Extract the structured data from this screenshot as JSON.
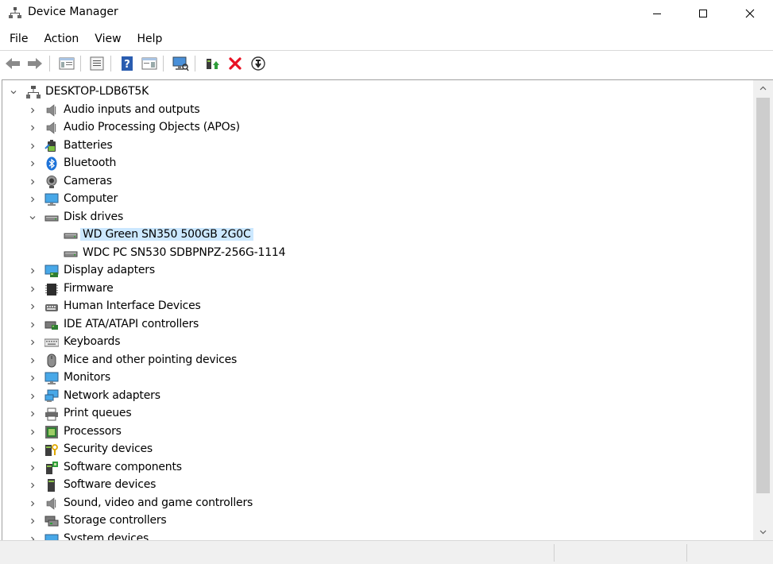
{
  "window": {
    "title": "Device Manager"
  },
  "menu": [
    "File",
    "Action",
    "View",
    "Help"
  ],
  "toolbar": [
    "back",
    "forward",
    "show-hide-console-tree",
    "properties",
    "help",
    "action-pane",
    "scan-hardware",
    "update-driver",
    "uninstall-device",
    "disable-device"
  ],
  "tree": {
    "root": "DESKTOP-LDB6T5K",
    "items": [
      {
        "label": "Audio inputs and outputs",
        "icon": "speaker-icon",
        "expanded": false
      },
      {
        "label": "Audio Processing Objects (APOs)",
        "icon": "speaker-icon",
        "expanded": false
      },
      {
        "label": "Batteries",
        "icon": "battery-icon",
        "expanded": false
      },
      {
        "label": "Bluetooth",
        "icon": "bluetooth-icon",
        "expanded": false
      },
      {
        "label": "Cameras",
        "icon": "camera-icon",
        "expanded": false
      },
      {
        "label": "Computer",
        "icon": "computer-icon",
        "expanded": false
      },
      {
        "label": "Disk drives",
        "icon": "disk-drive-icon",
        "expanded": true,
        "children": [
          {
            "label": "WD Green SN350 500GB 2G0C",
            "icon": "disk-drive-icon",
            "selected": true
          },
          {
            "label": "WDC PC SN530 SDBPNPZ-256G-1114",
            "icon": "disk-drive-icon",
            "selected": false
          }
        ]
      },
      {
        "label": "Display adapters",
        "icon": "display-adapter-icon",
        "expanded": false
      },
      {
        "label": "Firmware",
        "icon": "firmware-icon",
        "expanded": false
      },
      {
        "label": "Human Interface Devices",
        "icon": "hid-icon",
        "expanded": false
      },
      {
        "label": "IDE ATA/ATAPI controllers",
        "icon": "ide-controller-icon",
        "expanded": false
      },
      {
        "label": "Keyboards",
        "icon": "keyboard-icon",
        "expanded": false
      },
      {
        "label": "Mice and other pointing devices",
        "icon": "mouse-icon",
        "expanded": false
      },
      {
        "label": "Monitors",
        "icon": "monitor-icon",
        "expanded": false
      },
      {
        "label": "Network adapters",
        "icon": "network-adapter-icon",
        "expanded": false
      },
      {
        "label": "Print queues",
        "icon": "printer-icon",
        "expanded": false
      },
      {
        "label": "Processors",
        "icon": "processor-icon",
        "expanded": false
      },
      {
        "label": "Security devices",
        "icon": "security-device-icon",
        "expanded": false
      },
      {
        "label": "Software components",
        "icon": "software-component-icon",
        "expanded": false
      },
      {
        "label": "Software devices",
        "icon": "software-device-icon",
        "expanded": false
      },
      {
        "label": "Sound, video and game controllers",
        "icon": "speaker-icon",
        "expanded": false
      },
      {
        "label": "Storage controllers",
        "icon": "storage-controller-icon",
        "expanded": false
      },
      {
        "label": "System devices",
        "icon": "system-device-icon",
        "expanded": false
      }
    ]
  },
  "colors": {
    "selection": "#cce8ff",
    "accent": "#0078d7",
    "danger": "#e81123"
  }
}
